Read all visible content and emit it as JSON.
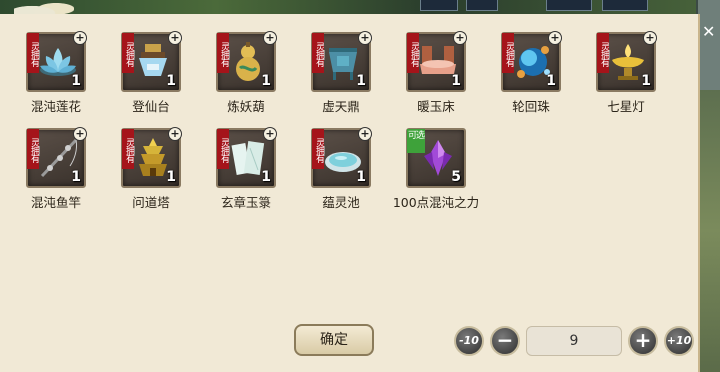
{
  "items": [
    {
      "name": "混沌莲花",
      "count": "1",
      "ribbon": "灵拥有",
      "ribbon_color": "#a5141a",
      "icon": "lotus-icon",
      "accent": "#8fd0e8"
    },
    {
      "name": "登仙台",
      "count": "1",
      "ribbon": "灵拥有",
      "ribbon_color": "#a5141a",
      "icon": "altar-icon",
      "accent": "#a6d8f0"
    },
    {
      "name": "炼妖葫",
      "count": "1",
      "ribbon": "灵拥有",
      "ribbon_color": "#a5141a",
      "icon": "gourd-icon",
      "accent": "#d9b24a"
    },
    {
      "name": "虚天鼎",
      "count": "1",
      "ribbon": "灵拥有",
      "ribbon_color": "#a5141a",
      "icon": "cauldron-icon",
      "accent": "#4c8fa6"
    },
    {
      "name": "暖玉床",
      "count": "1",
      "ribbon": "灵拥有",
      "ribbon_color": "#a5141a",
      "icon": "jade-bed-icon",
      "accent": "#e7a08a"
    },
    {
      "name": "轮回珠",
      "count": "1",
      "ribbon": "灵拥有",
      "ribbon_color": "#a5141a",
      "icon": "pearl-icon",
      "accent": "#3fa9e0"
    },
    {
      "name": "七星灯",
      "count": "1",
      "ribbon": "灵拥有",
      "ribbon_color": "#a5141a",
      "icon": "lamp-icon",
      "accent": "#e8c03a"
    },
    {
      "name": "混沌鱼竿",
      "count": "1",
      "ribbon": "灵拥有",
      "ribbon_color": "#a5141a",
      "icon": "fishing-rod-icon",
      "accent": "#9a9a9a"
    },
    {
      "name": "问道塔",
      "count": "1",
      "ribbon": "灵拥有",
      "ribbon_color": "#a5141a",
      "icon": "pagoda-icon",
      "accent": "#d6b43a"
    },
    {
      "name": "玄章玉箓",
      "count": "1",
      "ribbon": "灵拥有",
      "ribbon_color": "#a5141a",
      "icon": "jade-scroll-icon",
      "accent": "#d8ece6"
    },
    {
      "name": "蕴灵池",
      "count": "1",
      "ribbon": "灵拥有",
      "ribbon_color": "#a5141a",
      "icon": "spirit-pool-icon",
      "accent": "#7fd0dc"
    },
    {
      "name": "100点混沌之力",
      "count": "5",
      "ribbon": "可选",
      "ribbon_color": "#3ea23a",
      "icon": "chaos-crystal-icon",
      "accent": "#a24ad8"
    }
  ],
  "controls": {
    "confirm_label": "确定",
    "minus10_label": "-10",
    "minus_label": "−",
    "quantity_value": "9",
    "plus_label": "+",
    "plus10_label": "+10"
  }
}
